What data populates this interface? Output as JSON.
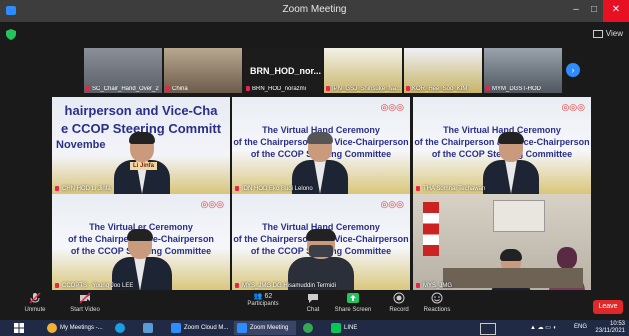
{
  "window": {
    "title": "Zoom Meeting",
    "minimize": "–",
    "maximize": "□",
    "close": "✕"
  },
  "view_label": "View",
  "thumbnails": [
    {
      "name": "SC_Chair_Hand_Over_2"
    },
    {
      "name": "China"
    },
    {
      "name": "BRN_HOD_norazmi",
      "big": "BRN_HOD_nor..."
    },
    {
      "name": "IPN_GSJ_Shinsuke_Na..."
    },
    {
      "name": "KOR_Hee_Soo_KIM"
    },
    {
      "name": "MYM_DGST-HOD"
    }
  ],
  "tiles": [
    {
      "name": "CHN HOD Li Jinfa",
      "line1": "hairperson and Vice-Cha",
      "line2": "e CCOP Steering Committ",
      "line3": "Novembe",
      "badge": "Li Jinfa"
    },
    {
      "name": "IDN HOD Eko Budi Lelono",
      "line1": "The Virtual Hand Ceremony",
      "line2": "of the Chairperson and Vice-Chairperson",
      "line3": "of the CCOP Steering Committee"
    },
    {
      "name": "THA Somnai Techawan",
      "line1": "The Virtual Hand Ceremony",
      "line2": "of the Chairperson and Vice-Chairperson",
      "line3": "of the CCOP Steering Committee"
    },
    {
      "name": "CCOPTS - Young Joo LEE",
      "line1": "The Virtual     er Ceremony",
      "line2": "of the Chairpers         Vice-Chairperson",
      "line3": "of the CCOP Steering Committee"
    },
    {
      "name": "MYS_JMG DG Hisamuddin Termidi",
      "line1": "The Virtual Hand Ceremony",
      "line2": "of the Chairperson and Vice-Chairperson",
      "line3": "of the CCOP Steering Committee"
    },
    {
      "name": "MYS_JMG"
    }
  ],
  "toolbar": {
    "unmute": "Unmute",
    "start_video": "Start Video",
    "participants": "Participants",
    "participants_count": "62",
    "chat": "Chat",
    "share_screen": "Share Screen",
    "record": "Record",
    "reactions": "Reactions",
    "leave": "Leave"
  },
  "taskbar": {
    "items": [
      "My Meetings -...",
      "Zoom Cloud M...",
      "Zoom Meeting",
      "LINE"
    ],
    "lang": "ENG",
    "time": "10:53",
    "date": "23/11/2021"
  },
  "colors": {
    "accent": "#2d8cff",
    "leave": "#e02828",
    "active_speaker": "#f5d21b",
    "share": "#23c45e"
  }
}
